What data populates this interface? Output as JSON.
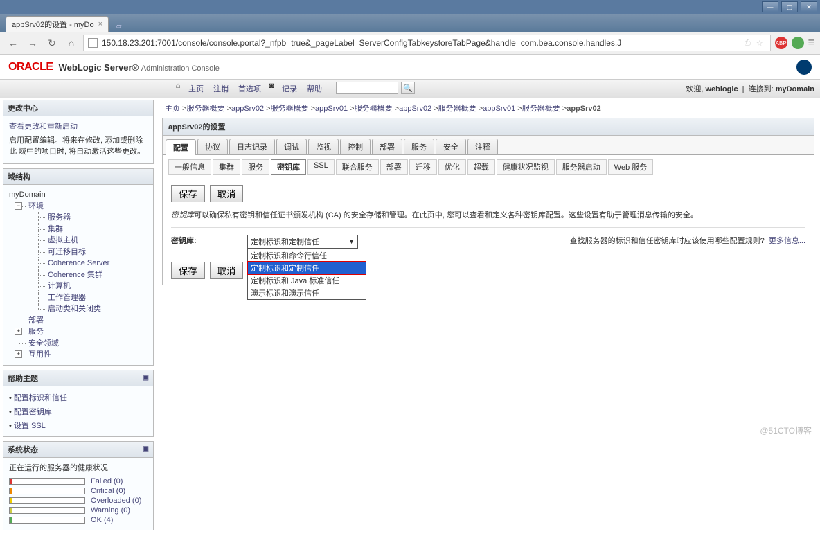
{
  "browser": {
    "tab_title": "appSrv02的设置 - myDo",
    "url": "150.18.23.201:7001/console/console.portal?_nfpb=true&_pageLabel=ServerConfigTabkeystoreTabPage&handle=com.bea.console.handles.J",
    "badge_abp": "ABP"
  },
  "header": {
    "oracle": "ORACLE",
    "product": "WebLogic Server®",
    "subtitle": "Administration Console"
  },
  "toolbar": {
    "home_icon": "⌂",
    "home": "主页",
    "logout": "注销",
    "prefs": "首选项",
    "record_icon": "◙",
    "record": "记录",
    "help": "帮助",
    "search_icon": "🔍",
    "welcome": "欢迎,",
    "user": "weblogic",
    "connected": "连接到:",
    "domain": "myDomain"
  },
  "change_center": {
    "title": "更改中心",
    "link": "查看更改和重新启动",
    "text": "启用配置编辑。将来在修改, 添加或删除此 域中的项目时, 将自动激活这些更改。"
  },
  "dom_struct": {
    "title": "域结构",
    "root": "myDomain",
    "env": "环境",
    "items": [
      "服务器",
      "集群",
      "虚拟主机",
      "可迁移目标",
      "Coherence Server",
      "Coherence 集群",
      "计算机",
      "工作管理器",
      "启动类和关闭类"
    ],
    "deploy": "部署",
    "services": "服务",
    "security": "安全领域",
    "interop": "互用性"
  },
  "help_topics": {
    "title": "帮助主题",
    "items": [
      "配置标识和信任",
      "配置密钥库",
      "设置 SSL"
    ]
  },
  "system_status": {
    "title": "系统状态",
    "subtitle": "正在运行的服务器的健康状况",
    "rows": [
      {
        "label": "Failed (0)",
        "color": "#d33",
        "w": 4
      },
      {
        "label": "Critical (0)",
        "color": "#e80",
        "w": 4
      },
      {
        "label": "Overloaded (0)",
        "color": "#ec0",
        "w": 4
      },
      {
        "label": "Warning (0)",
        "color": "#cc4",
        "w": 4
      },
      {
        "label": "OK (4)",
        "color": "#5a5",
        "w": 4
      }
    ]
  },
  "breadcrumb": {
    "items": [
      "主页",
      "服务器概要",
      "appSrv02",
      "服务器概要",
      "appSrv01",
      "服务器概要",
      "appSrv02",
      "服务器概要",
      "appSrv01",
      "服务器概要",
      "appSrv02"
    ]
  },
  "page": {
    "title": "appSrv02的设置",
    "tabs": [
      "配置",
      "协议",
      "日志记录",
      "调试",
      "监视",
      "控制",
      "部署",
      "服务",
      "安全",
      "注释"
    ],
    "active_tab": 0,
    "subtabs": [
      "一般信息",
      "集群",
      "服务",
      "密钥库",
      "SSL",
      "联合服务",
      "部署",
      "迁移",
      "优化",
      "超载",
      "健康状况监视",
      "服务器启动",
      "Web 服务"
    ],
    "active_subtab": 3,
    "save": "保存",
    "cancel": "取消",
    "desc_prefix": "密钥库",
    "desc": "可以确保私有密钥和信任证书颁发机构 (CA) 的安全存储和管理。在此页中, 您可以查看和定义各种密钥库配置。这些设置有助于管理消息传输的安全。",
    "field_label": "密钥库:",
    "select_value": "定制标识和定制信任",
    "options": [
      "定制标识和命令行信任",
      "定制标识和定制信任",
      "定制标识和 Java 标准信任",
      "演示标识和演示信任"
    ],
    "selected_option": 1,
    "hint": "查找服务器的标识和信任密钥库时应该使用哪些配置规则?",
    "more": "更多信息..."
  },
  "watermark": "@51CTO博客"
}
